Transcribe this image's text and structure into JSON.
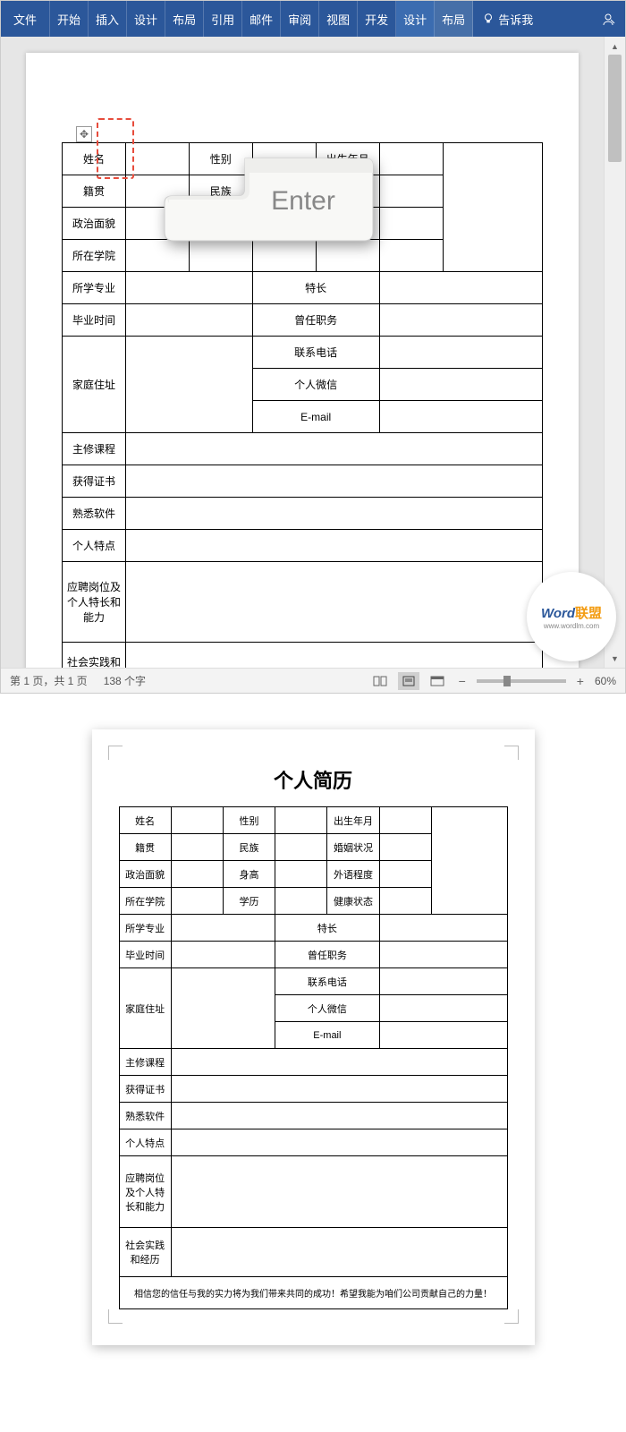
{
  "ribbon": {
    "file": "文件",
    "tabs": [
      "开始",
      "插入",
      "设计",
      "布局",
      "引用",
      "邮件",
      "审阅",
      "视图",
      "开发",
      "设计",
      "布局"
    ],
    "tell_me": "告诉我",
    "share_icon": "分享"
  },
  "enter_key": "Enter",
  "form": {
    "r1": {
      "name": "姓名",
      "gender": "性别",
      "birth": "出生年月"
    },
    "r2": {
      "place": "籍贯",
      "ethnic": "民族",
      "marriage": "况"
    },
    "r3": {
      "political": "政治面貌"
    },
    "r4": {
      "college": "所在学院"
    },
    "r5": {
      "major": "所学专业",
      "specialty": "特长"
    },
    "r6": {
      "gradtime": "毕业时间",
      "position": "曾任职务"
    },
    "r7": {
      "address": "家庭住址",
      "phone": "联系电话",
      "wechat": "个人微信",
      "email": "E-mail"
    },
    "r8": "主修课程",
    "r9": "获得证书",
    "r10": "熟悉软件",
    "r11": "个人特点",
    "r12": "应聘岗位及个人特长和能力",
    "r13": "社会实践和经历"
  },
  "watermark": {
    "brand1": "Word",
    "brand2": "联盟",
    "url": "www.wordlm.com"
  },
  "statusbar": {
    "page": "第 1 页，共 1 页",
    "words": "138 个字",
    "zoom": "60%"
  },
  "preview": {
    "title": "个人简历",
    "r1": {
      "name": "姓名",
      "gender": "性别",
      "birth": "出生年月"
    },
    "r2": {
      "place": "籍贯",
      "ethnic": "民族",
      "marriage": "婚姻状况"
    },
    "r3": {
      "political": "政治面貌",
      "height": "身高",
      "lang": "外语程度"
    },
    "r4": {
      "college": "所在学院",
      "edu": "学历",
      "health": "健康状态"
    },
    "r5": {
      "major": "所学专业",
      "specialty": "特长"
    },
    "r6": {
      "gradtime": "毕业时间",
      "position": "曾任职务"
    },
    "r7": {
      "address": "家庭住址",
      "phone": "联系电话",
      "wechat": "个人微信",
      "email": "E-mail"
    },
    "r8": "主修课程",
    "r9": "获得证书",
    "r10": "熟悉软件",
    "r11": "个人特点",
    "r12": "应聘岗位及个人特长和能力",
    "r13": "社会实践和经历",
    "footer": "相信您的信任与我的实力将为我们带来共同的成功！希望我能为咱们公司贡献自己的力量！"
  }
}
